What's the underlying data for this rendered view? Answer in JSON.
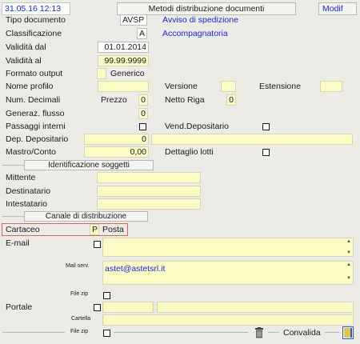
{
  "header": {
    "datetime": "31.05.16 12:13",
    "title": "Metodi distribuzione documenti",
    "mode": "Modif"
  },
  "form": {
    "tipo_documento": {
      "label": "Tipo documento",
      "code": "AVSP",
      "desc": "Avviso di spedizione"
    },
    "classificazione": {
      "label": "Classificazione",
      "code": "A",
      "desc": "Accompagnatoria"
    },
    "validita_dal": {
      "label": "Validità dal",
      "value": "01.01.2014"
    },
    "validita_al": {
      "label": "Validità  al",
      "value": "99.99.9999"
    },
    "formato_output": {
      "label": "Formato output",
      "value": "",
      "desc": "Generico"
    },
    "nome_profilo": {
      "label": "Nome profilo",
      "value": ""
    },
    "versione": {
      "label": "Versione",
      "value": ""
    },
    "estensione": {
      "label": "Estensione",
      "value": ""
    },
    "num_decimali": {
      "label": "Num. Decimali"
    },
    "prezzo": {
      "label": "Prezzo",
      "value": "0"
    },
    "netto_riga": {
      "label": "Netto Riga",
      "value": "0"
    },
    "generaz_flusso": {
      "label": "Generaz. flusso",
      "value": "0"
    },
    "passaggi_interni": {
      "label": "Passaggi interni"
    },
    "vend_depositario": {
      "label": "Vend.Depositario"
    },
    "dep_depositario": {
      "label": "Dep. Depositario",
      "value": "0",
      "desc": ""
    },
    "mastro_conto": {
      "label": "Mastro/Conto",
      "value": "0,00"
    },
    "dettaglio_lotti": {
      "label": "Dettaglio lotti"
    }
  },
  "soggetti": {
    "section_title": "Identificazione soggetti",
    "mittente": {
      "label": "Mittente",
      "value": ""
    },
    "destinatario": {
      "label": "Destinatario",
      "value": ""
    },
    "intestatario": {
      "label": "Intestatario",
      "value": ""
    }
  },
  "canale": {
    "section_title": "Canale di distribuzione",
    "cartaceo": {
      "label": "Cartaceo",
      "code": "P",
      "desc": "Posta"
    },
    "email": {
      "label": "E-mail",
      "value": ""
    },
    "mail_serv": {
      "label": "Mail serv.",
      "value": "astet@astetsrl.it"
    },
    "file_zip_1": {
      "label": "File zip"
    },
    "portale": {
      "label": "Portale",
      "value1": "",
      "value2": ""
    },
    "cartella": {
      "label": "Cartella",
      "value": ""
    },
    "file_zip_2": {
      "label": "File zip"
    }
  },
  "footer": {
    "delete_icon": "trash-icon",
    "convalida_label": "Convalida",
    "exit_icon": "exit-door-icon"
  },
  "colors": {
    "field_bg": "#fcfbc3",
    "label_blue": "#1b25d6",
    "highlight_border": "#e06060",
    "window_bg": "#ecebe6"
  }
}
